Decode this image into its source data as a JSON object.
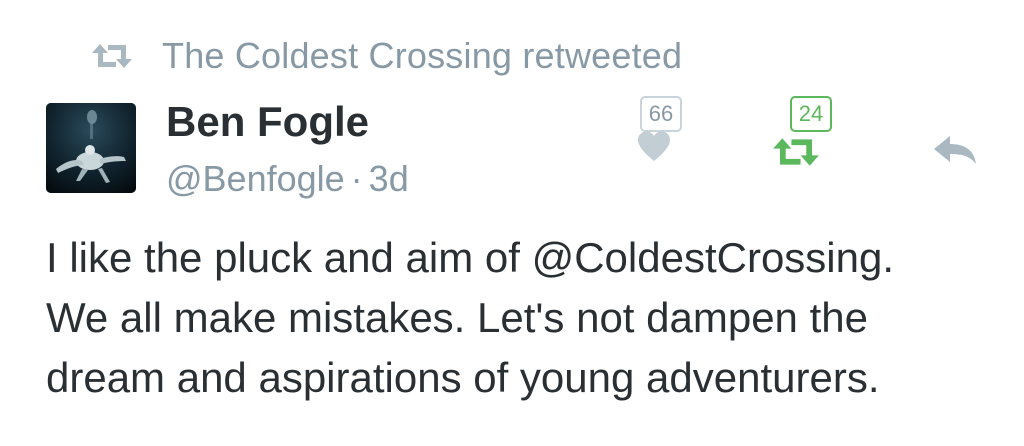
{
  "context": {
    "icon": "retweet-icon",
    "text": "The Coldest Crossing retweeted"
  },
  "author": {
    "avatar": "avatar-image",
    "name": "Ben Fogle",
    "handle": "@Benfogle",
    "separator": "·",
    "time": "3d"
  },
  "actions": {
    "favorite": {
      "icon": "heart-icon",
      "count": "66",
      "color": "#c3cdd4"
    },
    "retweet": {
      "icon": "retweet-icon",
      "count": "24",
      "color": "#5cb85c"
    },
    "reply": {
      "icon": "reply-icon",
      "color": "#aab8c2"
    }
  },
  "tweet": {
    "lines": [
      "I like the pluck and aim of @ColdestCrossing.",
      "We all make mistakes. Let's not dampen the",
      "dream and aspirations of young adventurers."
    ]
  }
}
